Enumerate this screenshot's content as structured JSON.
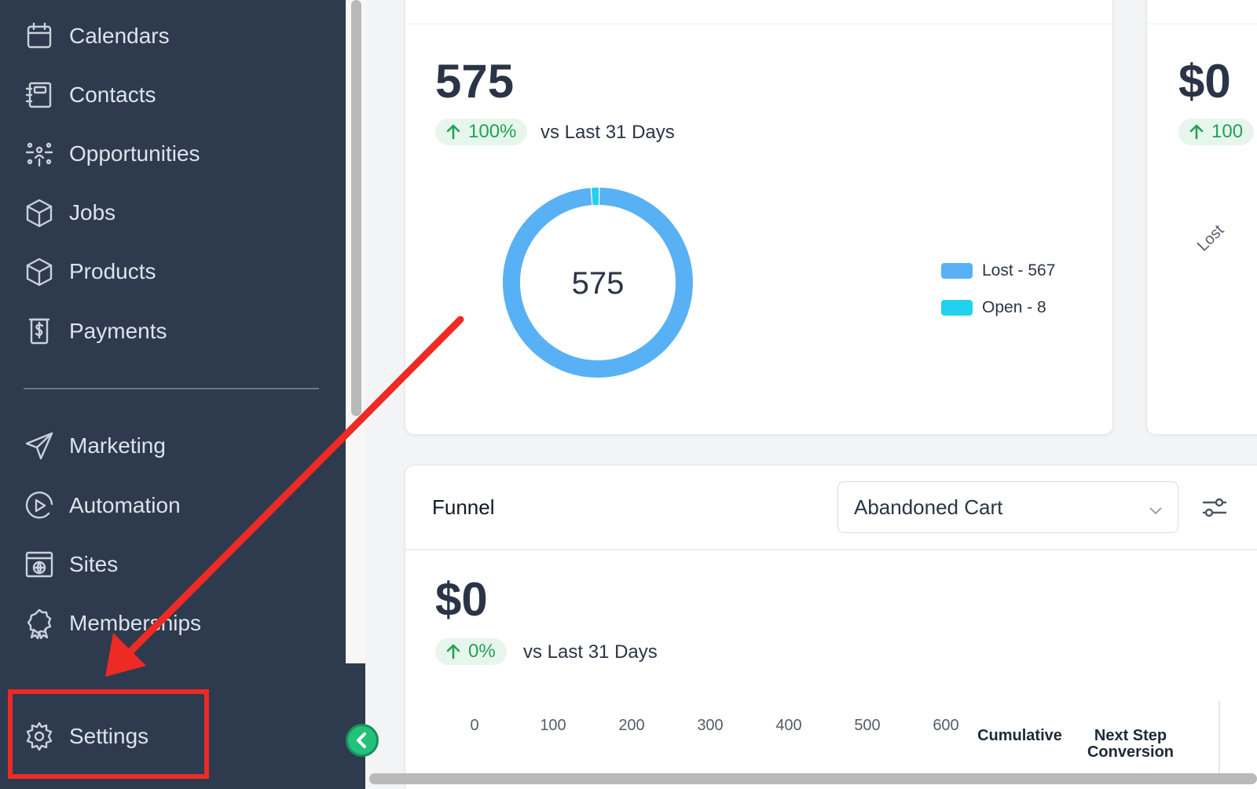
{
  "sidebar": {
    "items": [
      {
        "label": "Calendars",
        "icon": "calendar-icon"
      },
      {
        "label": "Contacts",
        "icon": "contacts-book-icon"
      },
      {
        "label": "Opportunities",
        "icon": "opportunities-network-icon"
      },
      {
        "label": "Jobs",
        "icon": "box-icon"
      },
      {
        "label": "Products",
        "icon": "box-icon"
      },
      {
        "label": "Payments",
        "icon": "receipt-dollar-icon"
      },
      {
        "label": "Marketing",
        "icon": "send-icon"
      },
      {
        "label": "Automation",
        "icon": "play-circle-icon"
      },
      {
        "label": "Sites",
        "icon": "globe-window-icon"
      },
      {
        "label": "Memberships",
        "icon": "award-badge-icon"
      }
    ],
    "settings_label": "Settings"
  },
  "opportunity_card": {
    "total": "575",
    "delta": "100%",
    "compare": "vs Last 31 Days",
    "donut_center": "575",
    "legend": [
      {
        "label": "Lost - 567",
        "color": "#58b1f5",
        "value": 567
      },
      {
        "label": "Open - 8",
        "color": "#22d1ee",
        "value": 8
      }
    ]
  },
  "side_card": {
    "value": "$0",
    "delta": "100",
    "axis_label": "Lost"
  },
  "funnel": {
    "title": "Funnel",
    "selected_option": "Abandoned Cart",
    "value": "$0",
    "delta": "0%",
    "compare": "vs Last 31 Days",
    "axis_ticks": [
      "0",
      "100",
      "200",
      "300",
      "400",
      "500",
      "600"
    ],
    "columns": [
      "Cumulative",
      "Next Step Conversion"
    ]
  },
  "colors": {
    "sidebar_bg": "#2e3a4d",
    "accent_green": "#22c27a",
    "annotation_red": "#ee2a24"
  }
}
